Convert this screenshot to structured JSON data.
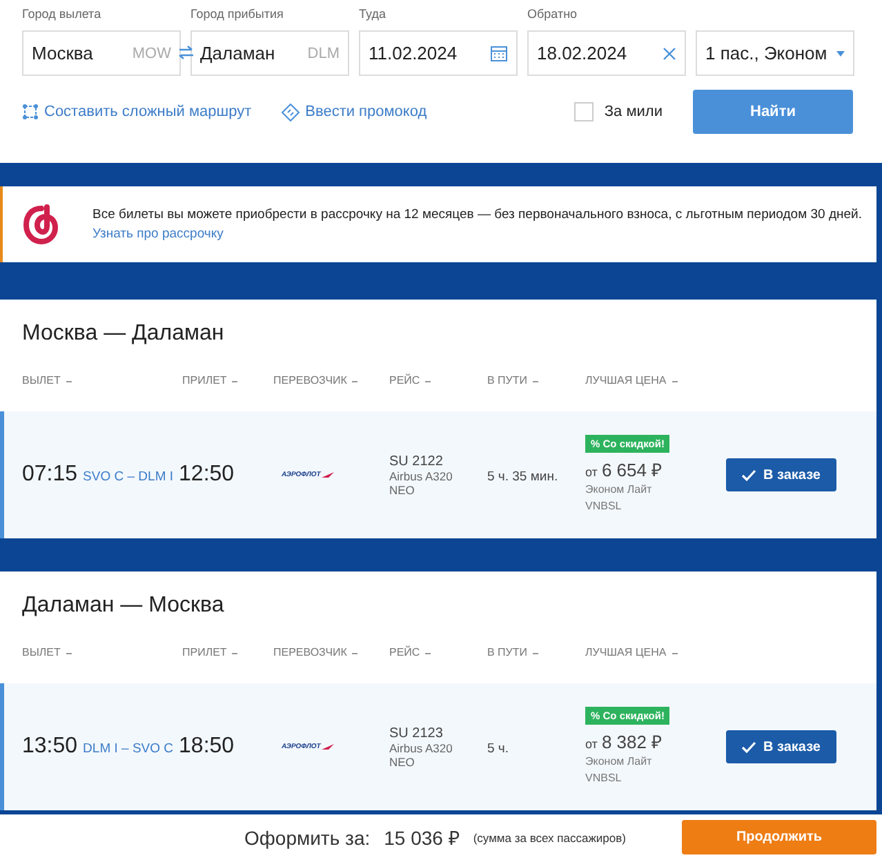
{
  "search": {
    "fields": [
      {
        "kind": "city",
        "label": "Город вылета",
        "value": "Москва",
        "code": "MOW"
      },
      {
        "kind": "city",
        "label": "Город прибытия",
        "value": "Даламан",
        "code": "DLM"
      },
      {
        "kind": "date",
        "label": "Туда",
        "value": "11.02.2024"
      },
      {
        "kind": "returndate",
        "label": "Обратно",
        "value": "18.02.2024"
      },
      {
        "kind": "select",
        "value": "1 пас., Эконом"
      }
    ],
    "links": [
      {
        "kind": "route",
        "label": "Составить сложный маршрут"
      },
      {
        "kind": "promo",
        "label": "Ввести промокод"
      }
    ],
    "miles": {
      "label": "За мили",
      "checked": false
    },
    "search_button": "Найти"
  },
  "banner": {
    "text": "Все билеты вы можете приобрести в рассрочку на 12 месяцев — без первоначального взноса, с льготным периодом 30 дней.",
    "link": "Узнать про рассрочку"
  },
  "legs": [
    {
      "title": "Москва — Даламан",
      "columns": [
        "ВЫЛЕТ",
        "ПРИЛЕТ",
        "ПЕРЕВОЗЧИК",
        "РЕЙС",
        "В ПУТИ",
        "ЛУЧШАЯ ЦЕНА"
      ],
      "flight": {
        "departure": "07:15",
        "route": "SVO C – DLM I",
        "arrival": "12:50",
        "carrier": "АЭРОФЛОТ",
        "number": "SU 2122",
        "aircraft": "Airbus A320 NEO",
        "duration": "5 ч. 35 мин.",
        "badge": "% Со скидкой!",
        "price_prefix": "от",
        "price": "6 654 ₽",
        "fare": "Эконом Лайт",
        "fare_code": "VNBSL",
        "button": "В заказе",
        "selected": true
      }
    },
    {
      "title": "Даламан — Москва",
      "columns": [
        "ВЫЛЕТ",
        "ПРИЛЕТ",
        "ПЕРЕВОЗЧИК",
        "РЕЙС",
        "В ПУТИ",
        "ЛУЧШАЯ ЦЕНА"
      ],
      "flight": {
        "departure": "13:50",
        "route": "DLM I – SVO C",
        "arrival": "18:50",
        "carrier": "АЭРОФЛОТ",
        "number": "SU 2123",
        "aircraft": "Airbus A320 NEO",
        "duration": "5 ч.",
        "badge": "% Со скидкой!",
        "price_prefix": "от",
        "price": "8 382 ₽",
        "fare": "Эконом Лайт",
        "fare_code": "VNBSL",
        "button": "В заказе",
        "selected": true
      }
    }
  ],
  "footer": {
    "label": "Оформить за:",
    "total": "15 036 ₽",
    "note": "(сумма за всех пассажиров)",
    "button": "Продолжить"
  }
}
